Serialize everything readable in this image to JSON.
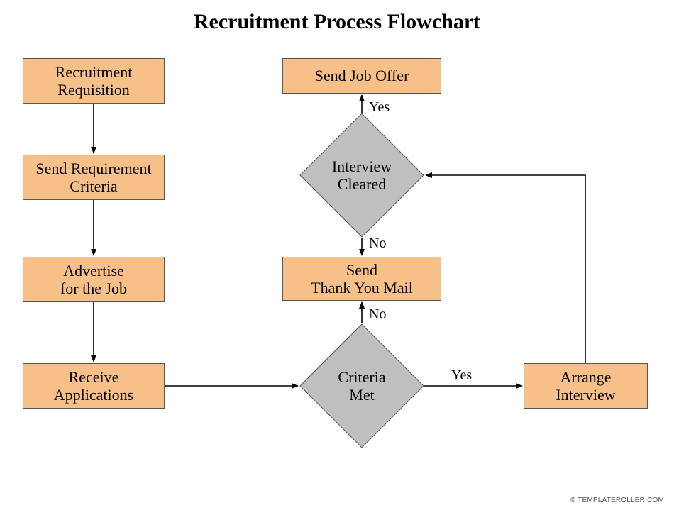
{
  "title": "Recruitment Process Flowchart",
  "nodes": {
    "requisition": "Recruitment\nRequisition",
    "send_criteria": "Send Requirement\nCriteria",
    "advertise": "Advertise\nfor the Job",
    "receive_apps": "Receive\nApplications",
    "criteria_met": "Criteria\nMet",
    "arrange_interview": "Arrange\nInterview",
    "interview_cleared": "Interview\nCleared",
    "send_offer": "Send Job Offer",
    "thank_you": "Send\nThank You Mail"
  },
  "edge_labels": {
    "criteria_yes": "Yes",
    "criteria_no": "No",
    "interview_yes": "Yes",
    "interview_no": "No"
  },
  "footer": "© TEMPLATEROLLER.COM",
  "colors": {
    "process": "#f7c088",
    "decision": "#bfbfbf",
    "border": "#555555",
    "arrow": "#000000"
  }
}
